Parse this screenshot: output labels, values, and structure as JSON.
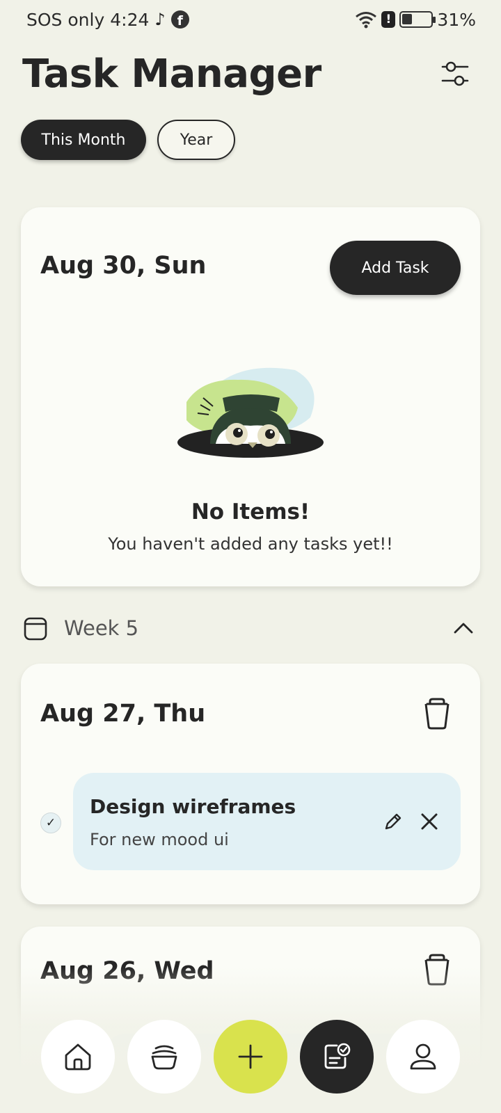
{
  "status_bar": {
    "carrier": "SOS only",
    "time": "4:24",
    "battery": "31%",
    "icons": [
      "tiktok-icon",
      "facebook-icon",
      "wifi-icon",
      "alert-icon",
      "battery-saver-icon"
    ]
  },
  "header": {
    "title": "Task Manager",
    "filter_icon": "sliders-icon"
  },
  "filters": {
    "active": "This Month",
    "inactive": "Year"
  },
  "today_card": {
    "date": "Aug 30, Sun",
    "add_button": "Add Task",
    "empty_title": "No Items!",
    "empty_subtitle": "You haven't added any tasks yet!!"
  },
  "week": {
    "label": "Week 5",
    "icon": "calendar-icon",
    "toggle_icon": "chevron-up-icon"
  },
  "days": [
    {
      "date": "Aug 27, Thu",
      "tasks": [
        {
          "title": "Design wireframes",
          "description": "For new mood ui",
          "done": true
        }
      ]
    },
    {
      "date": "Aug 26, Wed"
    }
  ],
  "bottom_nav": [
    "home-icon",
    "bowl-icon",
    "plus-icon",
    "task-list-icon",
    "profile-icon"
  ],
  "colors": {
    "background": "#f1f2e8",
    "card": "#fbfcf7",
    "dark": "#262626",
    "accent": "#d9e24d",
    "task_bg": "#e2f1f5"
  }
}
